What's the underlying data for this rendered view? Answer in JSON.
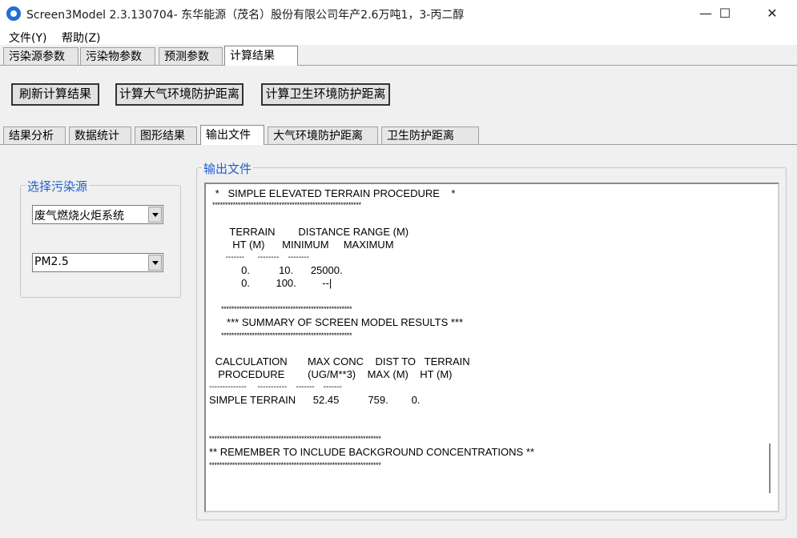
{
  "window": {
    "title": "Screen3Model 2.3.130704- 东华能源（茂名）股份有限公司年产2.6万吨1，3-丙二醇",
    "min_glyph": "—",
    "max_glyph": "☐",
    "close_glyph": "✕"
  },
  "menu": {
    "file": "文件(Y)",
    "help": "帮助(Z)"
  },
  "main_tabs": [
    "污染源参数",
    "污染物参数",
    "预测参数",
    "计算结果"
  ],
  "buttons": {
    "refresh": "刷新计算结果",
    "atmo_distance": "计算大气环境防护距离",
    "health_distance": "计算卫生环境防护距离"
  },
  "sub_tabs": [
    "结果分析",
    "数据统计",
    "图形结果",
    "输出文件",
    "大气环境防护距离",
    "卫生防护距离"
  ],
  "source_group": {
    "legend": "选择污染源",
    "source_value": "废气燃烧火炬系统",
    "pollutant_value": "PM2.5"
  },
  "output_group": {
    "legend": "输出文件",
    "lines": [
      " *   SIMPLE ELEVATED TERRAIN PROCEDURE    *",
      "**********************************************************",
      "",
      "      TERRAIN        DISTANCE RANGE (M)",
      "       HT (M)      MINIMUM     MAXIMUM",
      "      -------      --------    --------",
      "          0.          10.      25000.",
      "          0.         100.         --|",
      "",
      "     ***************************************************",
      "     *** SUMMARY OF SCREEN MODEL RESULTS ***",
      "     ***************************************************",
      "",
      " CALCULATION       MAX CONC    DIST TO   TERRAIN",
      "  PROCEDURE        (UG/M**3)    MAX (M)    HT (M)",
      "--------------     -----------    -------    -------",
      "SIMPLE TERRAIN      52.45          759.        0.",
      "",
      "",
      "*******************************************************************",
      "** REMEMBER TO INCLUDE BACKGROUND CONCENTRATIONS **",
      "*******************************************************************"
    ]
  }
}
